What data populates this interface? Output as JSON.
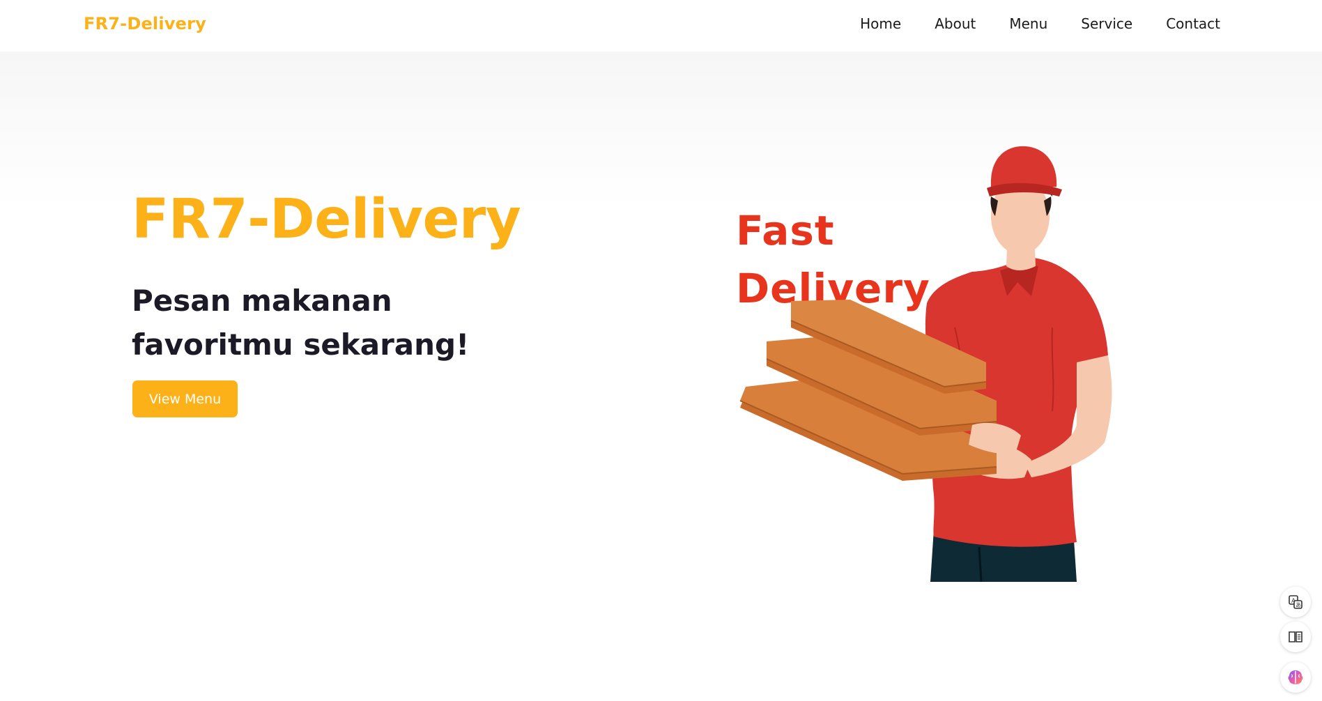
{
  "navbar": {
    "brand": "FR7-Delivery",
    "links": [
      "Home",
      "About",
      "Menu",
      "Service",
      "Contact"
    ]
  },
  "hero": {
    "title": "FR7-Delivery",
    "subtitle_line1": "Pesan makanan",
    "subtitle_line2": "favoritmu sekarang!",
    "button_label": "View Menu"
  },
  "illustration": {
    "text_line1": "Fast",
    "text_line2": "Delivery",
    "subject": "delivery-man-with-pizza-boxes"
  },
  "side_tools": [
    "translate-icon",
    "reader-icon",
    "brain-icon"
  ],
  "colors": {
    "accent": "#fbb117",
    "heading_dark": "#1c1a27",
    "fast_delivery_red": "#e8341c",
    "shirt_red": "#d93630"
  }
}
